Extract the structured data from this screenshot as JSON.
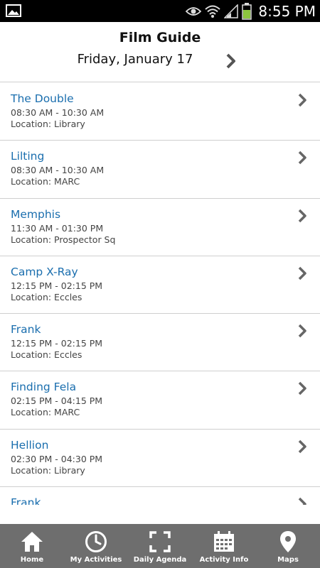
{
  "status_bar": {
    "time": "8:55 PM",
    "icons": [
      "image-notification-icon",
      "eye-icon",
      "wifi-icon",
      "signal-icon",
      "battery-icon"
    ],
    "battery_color": "#8dc63f"
  },
  "header": {
    "title": "Film Guide",
    "date": "Friday, January 17",
    "next_icon": "chevron-right-icon"
  },
  "films": [
    {
      "title": "The Double",
      "time": "08:30 AM - 10:30 AM",
      "location": "Location: Library"
    },
    {
      "title": "Lilting",
      "time": "08:30 AM - 10:30 AM",
      "location": "Location: MARC"
    },
    {
      "title": "Memphis",
      "time": "11:30 AM - 01:30 PM",
      "location": "Location: Prospector Sq"
    },
    {
      "title": "Camp X-Ray",
      "time": "12:15 PM - 02:15 PM",
      "location": "Location: Eccles"
    },
    {
      "title": "Frank",
      "time": "12:15 PM - 02:15 PM",
      "location": "Location: Eccles"
    },
    {
      "title": "Finding Fela",
      "time": "02:15 PM - 04:15 PM",
      "location": "Location: MARC"
    },
    {
      "title": "Hellion",
      "time": "02:30 PM - 04:30 PM",
      "location": "Location: Library"
    },
    {
      "title": "Frank",
      "time": "",
      "location": ""
    }
  ],
  "tabs": [
    {
      "label": "Home",
      "icon": "home-icon"
    },
    {
      "label": "My Activities",
      "icon": "clock-icon"
    },
    {
      "label": "Daily Agenda",
      "icon": "expand-icon"
    },
    {
      "label": "Activity Info",
      "icon": "calendar-icon"
    },
    {
      "label": "Maps",
      "icon": "map-pin-icon"
    }
  ],
  "colors": {
    "link": "#1a6eae",
    "tab_bar": "#6e6e6e",
    "divider": "#cfcfcf"
  }
}
